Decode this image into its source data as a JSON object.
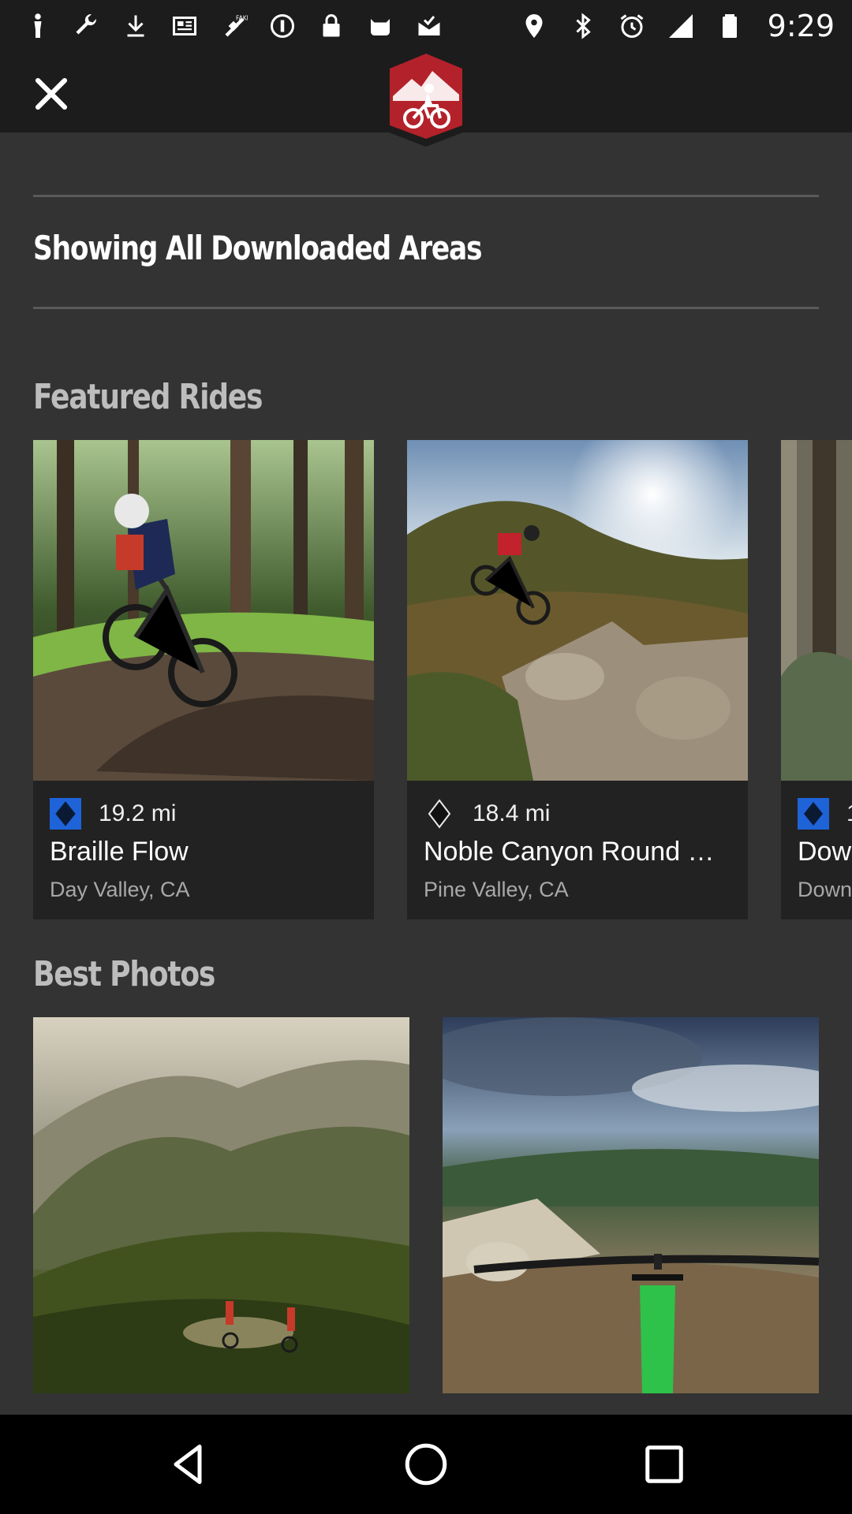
{
  "status_bar": {
    "time": "9:29",
    "left_icons": [
      "person-icon",
      "wrench-icon",
      "download-icon",
      "newspaper-icon",
      "fake-gps-icon",
      "info-circle-icon",
      "lock-icon",
      "cat-icon",
      "mail-check-icon"
    ],
    "right_icons": [
      "location-icon",
      "bluetooth-icon",
      "alarm-icon",
      "signal-icon",
      "battery-icon"
    ]
  },
  "toolbar": {
    "close_icon": "close-icon",
    "logo_icon": "mountain-bike-logo-icon"
  },
  "areas": {
    "title": "Showing All Downloaded Areas"
  },
  "featured": {
    "title": "Featured Rides",
    "rides": [
      {
        "distance": "19.2 mi",
        "name": "Braille Flow",
        "location": "Day Valley, CA",
        "difficulty": "blue-square-diamond",
        "photo": "rider on forest dirt trail"
      },
      {
        "distance": "18.4 mi",
        "name": "Noble Canyon Round …",
        "location": "Pine Valley, CA",
        "difficulty": "black-diamond",
        "photo": "rider on rocky hillside at sunset"
      },
      {
        "distance": "1",
        "name": "Dow",
        "location": "Down",
        "difficulty": "blue-square-diamond",
        "photo": "forest trail"
      }
    ]
  },
  "photos": {
    "title": "Best Photos",
    "items": [
      "riders descending misty hills",
      "handlebar view over rocky trail"
    ]
  },
  "nav": {
    "back_icon": "back-triangle-icon",
    "home_icon": "home-circle-icon",
    "recents_icon": "recents-square-icon"
  },
  "colors": {
    "background": "#333333",
    "card": "#222222",
    "bar": "#1c1c1c",
    "brand_red": "#b3222a",
    "blue_difficulty": "#1e63d8"
  }
}
